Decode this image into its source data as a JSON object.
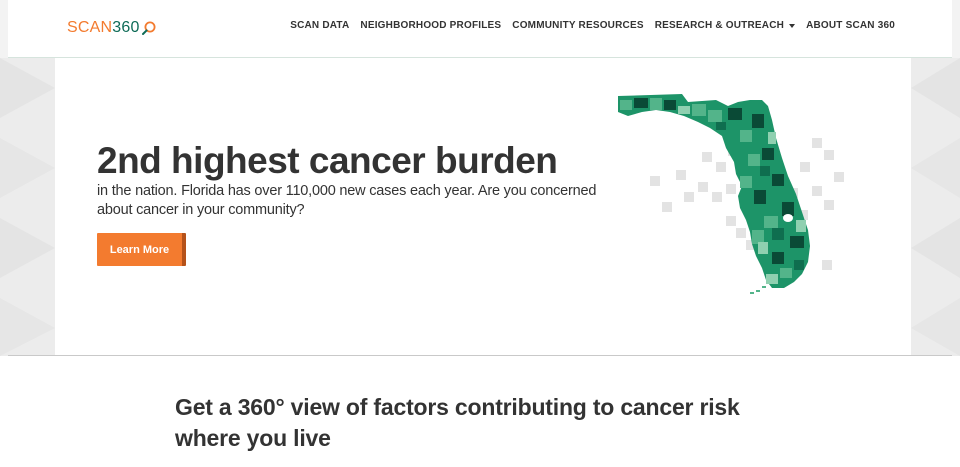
{
  "logo": {
    "scan": "SCAN",
    "num": "360"
  },
  "nav": {
    "items": [
      {
        "label": "SCAN DATA"
      },
      {
        "label": "NEIGHBORHOOD PROFILES"
      },
      {
        "label": "COMMUNITY RESOURCES"
      },
      {
        "label": "RESEARCH & OUTREACH",
        "dropdown": true
      },
      {
        "label": "ABOUT SCAN 360"
      }
    ]
  },
  "hero": {
    "headline": "2nd highest cancer burden",
    "subtext": "in the nation. Florida has over 110,000 new cases each year. Are you concerned about cancer in your community?",
    "button": "Learn More"
  },
  "section": {
    "heading": "Get a 360° view of factors contributing to cancer risk where you live"
  },
  "colors": {
    "accent": "#f37b2f",
    "brand_green": "#0e6b57",
    "map_greens": [
      "#0a4a36",
      "#0f6e4f",
      "#1d9468",
      "#53b48a",
      "#8fd0b0"
    ]
  }
}
